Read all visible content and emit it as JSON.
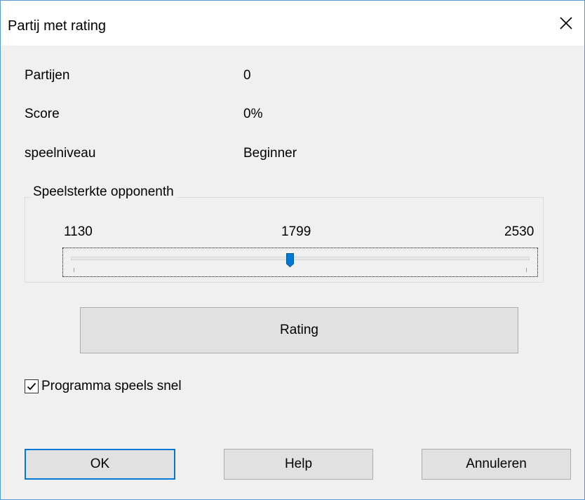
{
  "dialog": {
    "title": "Partij met rating",
    "close_icon": "close-icon"
  },
  "stats": {
    "games_label": "Partijen",
    "games_value": "0",
    "score_label": "Score",
    "score_value": "0%",
    "level_label": "speelniveau",
    "level_value": "Beginner"
  },
  "opponent_strength": {
    "group_label": "Speelsterkte opponenth",
    "min_label": "1130",
    "current_label": "1799",
    "max_label": "2530",
    "min": 1130,
    "max": 2530,
    "value": 1799
  },
  "rating_button_label": "Rating",
  "fast_play": {
    "label": "Programma speels snel",
    "checked": true
  },
  "footer": {
    "ok_label": "OK",
    "help_label": "Help",
    "cancel_label": "Annuleren"
  },
  "colors": {
    "accent": "#0078d7",
    "window_border": "#5b9bd5",
    "dialog_background": "#f0f0f0"
  }
}
